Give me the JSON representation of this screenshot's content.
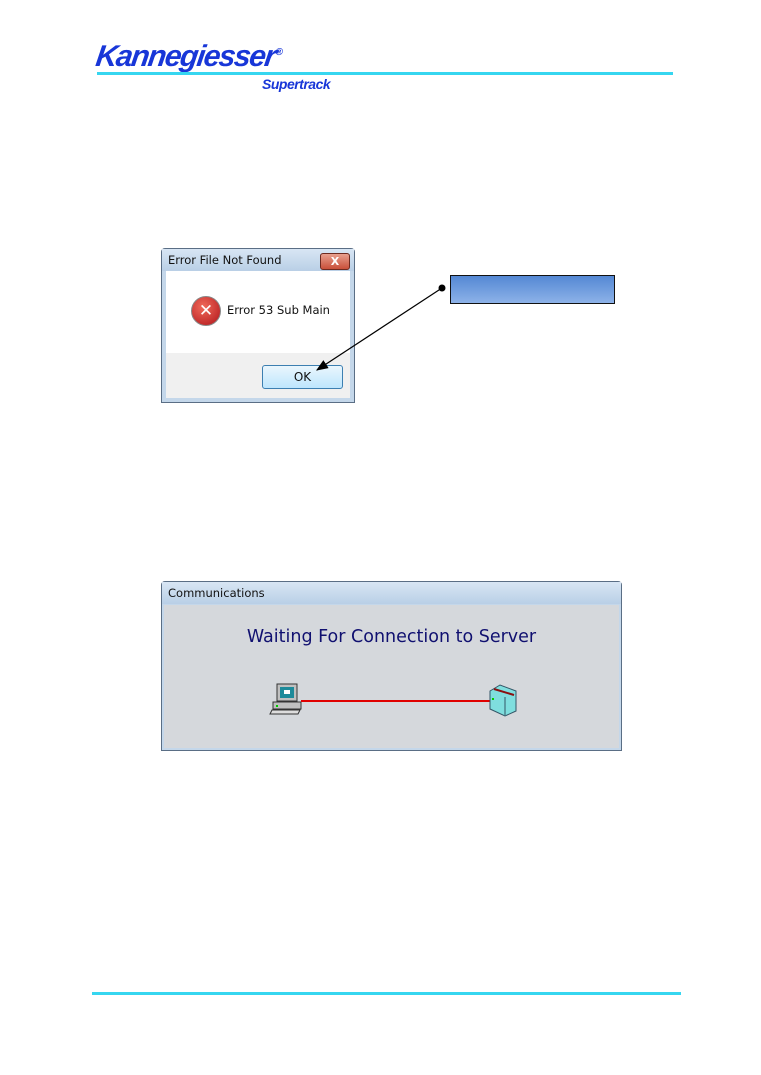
{
  "header": {
    "brand": "Kannegiesser",
    "registered": "®",
    "product": "Supertrack"
  },
  "error_dialog": {
    "title": "Error File Not Found",
    "close_label": "X",
    "message": "Error 53 Sub Main",
    "ok_label": "OK"
  },
  "comm_window": {
    "title": "Communications",
    "status": "Waiting For Connection to Server",
    "link_color": "#e00000"
  },
  "colors": {
    "brand": "#1836d8",
    "rule": "#36d6f0"
  }
}
